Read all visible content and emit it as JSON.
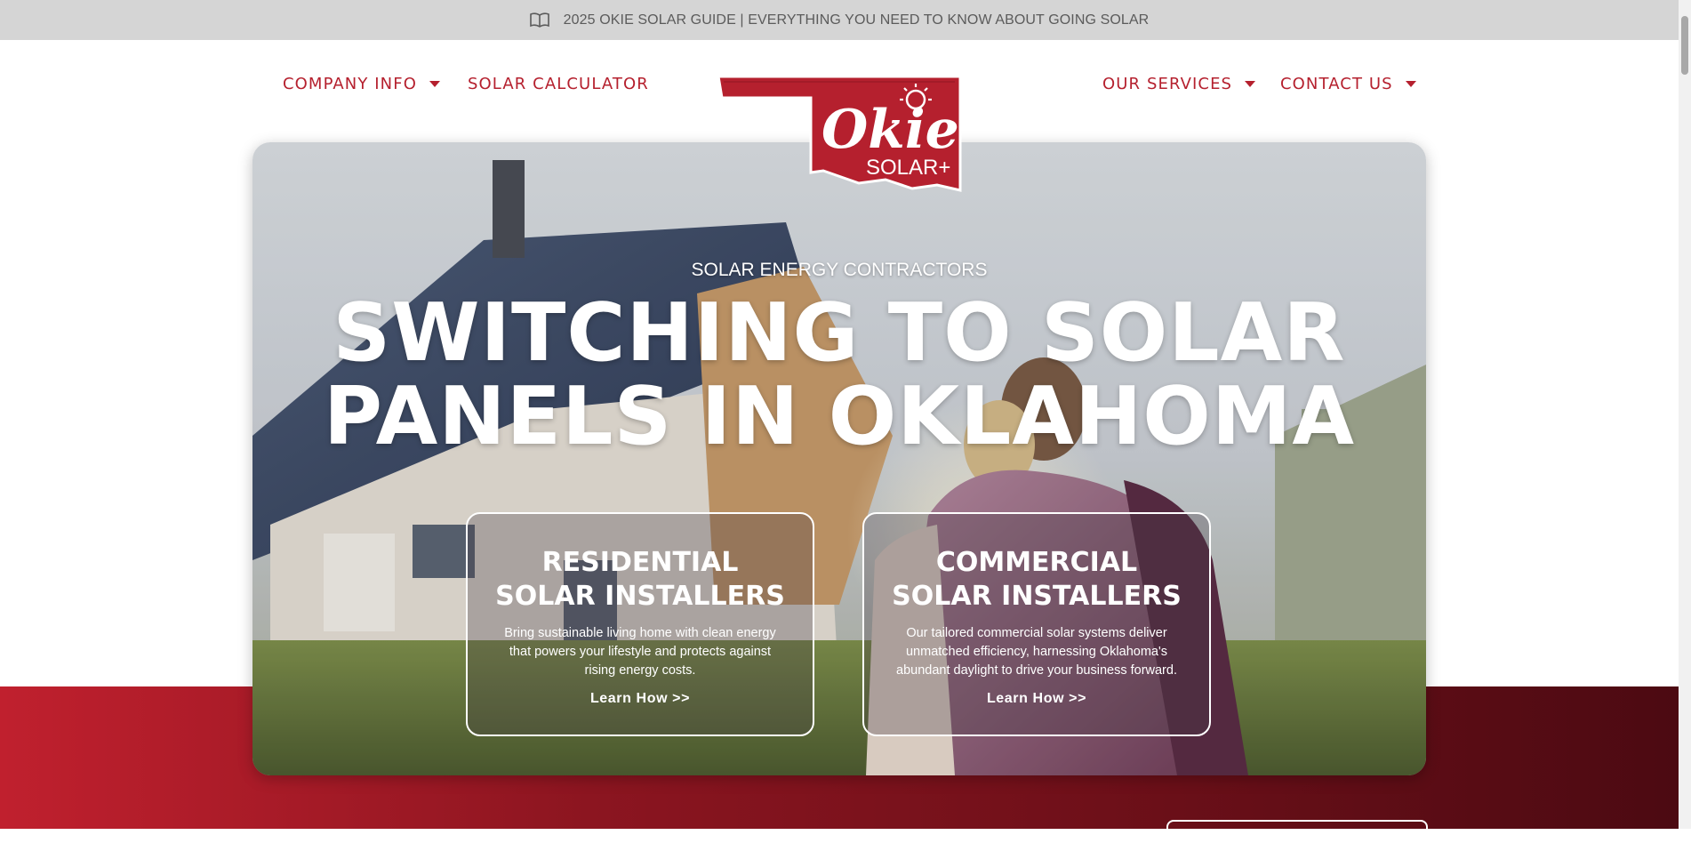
{
  "topbar": {
    "icon": "book-open-icon",
    "text": "2025 OKIE SOLAR GUIDE | EVERYTHING YOU NEED TO KNOW ABOUT GOING SOLAR"
  },
  "nav": {
    "company_info": "COMPANY INFO",
    "solar_calculator": "SOLAR CALCULATOR",
    "our_services": "OUR SERVICES",
    "contact_us": "CONTACT US"
  },
  "logo": {
    "word": "Okie",
    "sub": "SOLAR+"
  },
  "hero": {
    "subtitle": "SOLAR ENERGY CONTRACTORS",
    "title_line1": "SWITCHING TO SOLAR",
    "title_line2": "PANELS IN OKLAHOMA"
  },
  "cards": [
    {
      "title_line1": "RESIDENTIAL",
      "title_line2": "SOLAR INSTALLERS",
      "text": "Bring sustainable living home with clean energy that powers your lifestyle and protects against rising energy costs.",
      "link": "Learn How >>"
    },
    {
      "title_line1": "COMMERCIAL",
      "title_line2": "SOLAR INSTALLERS",
      "text": "Our tailored commercial solar systems deliver unmatched efficiency, harnessing Oklahoma's abundant daylight to drive your business forward.",
      "link": "Learn How >>"
    }
  ],
  "colors": {
    "brand_red": "#b5202e",
    "topbar_bg": "#d5d5d5"
  }
}
